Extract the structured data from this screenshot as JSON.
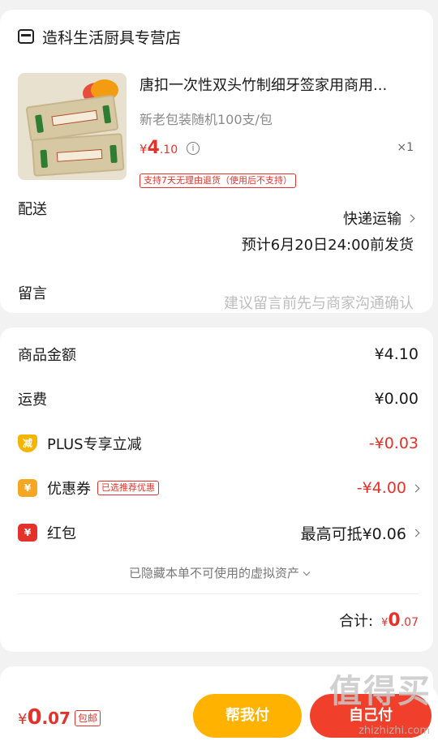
{
  "shop": {
    "name": "造科生活厨具专营店",
    "icon": "store-icon"
  },
  "product": {
    "title": "唐扣一次性双头竹制细牙签家用商用...",
    "spec": "新老包装随机100支/包",
    "price_currency": "¥",
    "price_int": "4",
    "price_dec": ".10",
    "info_icon": "i",
    "qty": "×1",
    "return_tag": "支持7天无理由退货（使用后不支持）"
  },
  "delivery": {
    "label": "配送",
    "method": "快递运输",
    "eta": "预计6月20日24:00前发货"
  },
  "message": {
    "label": "留言",
    "placeholder": "建议留言前先与商家沟通确认"
  },
  "amounts": {
    "goods_label": "商品金额",
    "goods_value": "¥4.10",
    "shipping_label": "运费",
    "shipping_value": "¥0.00",
    "plus_label": "PLUS专享立减",
    "plus_icon_text": "减",
    "plus_value": "-¥0.03",
    "coupon_label": "优惠券",
    "coupon_icon_text": "¥",
    "coupon_tag": "已选推荐优惠",
    "coupon_value": "-¥4.00",
    "redpacket_label": "红包",
    "redpacket_icon_text": "¥",
    "redpacket_value": "最高可抵¥0.06",
    "hidden_note": "已隐藏本单不可使用的虚拟资产"
  },
  "total": {
    "label": "合计:",
    "currency": "¥",
    "int": "0",
    "dec": ".07"
  },
  "bottom": {
    "currency": "¥",
    "int": "0",
    "dec": ".07",
    "free_shipping": "包邮",
    "help_button": "帮我付",
    "pay_button": "自己付"
  },
  "watermark": {
    "main": "值得买",
    "sub": "zhizhizhi.com"
  },
  "colors": {
    "accent_red": "#e4322b",
    "help_yellow": "#ffb300",
    "pay_red": "#f0402b"
  }
}
